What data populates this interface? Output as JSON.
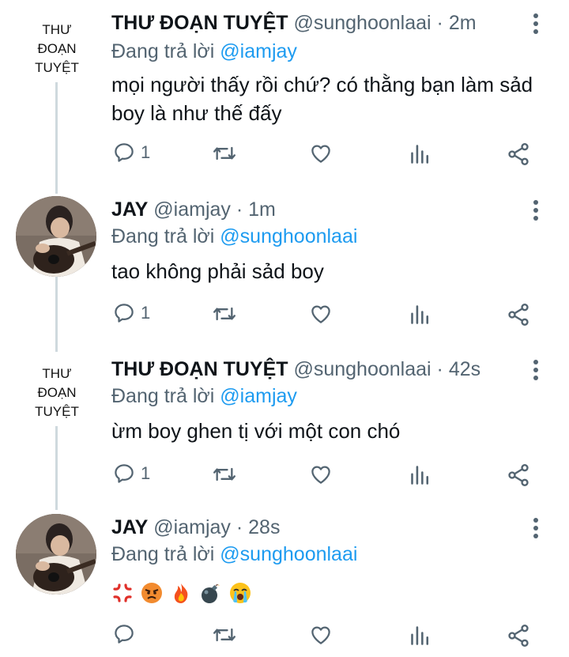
{
  "tweets": [
    {
      "avatar_text": [
        "THƯ",
        "ĐOẠN",
        "TUYỆT"
      ],
      "name": "THƯ ĐOẠN TUYỆT",
      "handle": "@sunghoonlaai",
      "time": "· 2m",
      "replying_prefix": "Đang trả lời",
      "replying_to": "@iamjay",
      "text": "mọi người thấy rồi chứ? có thằng bạn làm sảd boy là như thế đấy",
      "reply_count": "1"
    },
    {
      "name": "JAY",
      "handle": "@iamjay",
      "time": "· 1m",
      "replying_prefix": "Đang trả lời",
      "replying_to": "@sunghoonlaai",
      "text": "tao không phải sảd boy",
      "reply_count": "1"
    },
    {
      "avatar_text": [
        "THƯ",
        "ĐOẠN",
        "TUYỆT"
      ],
      "name": "THƯ ĐOẠN TUYỆT",
      "handle": "@sunghoonlaai",
      "time": "· 42s",
      "replying_prefix": "Đang trả lời",
      "replying_to": "@iamjay",
      "text": "ừm boy ghen tị với một con chó",
      "reply_count": "1"
    },
    {
      "name": "JAY",
      "handle": "@iamjay",
      "time": "· 28s",
      "replying_prefix": "Đang trả lời",
      "replying_to": "@sunghoonlaai",
      "emojis": [
        "anger-symbol",
        "angry-face",
        "fire",
        "bomb",
        "loudly-crying-face"
      ],
      "reply_count": ""
    }
  ],
  "icons": [
    "reply-icon",
    "retweet-icon",
    "like-icon",
    "views-icon",
    "share-icon",
    "more-icon"
  ],
  "colors": {
    "accent": "#1d9bf0",
    "secondary_text": "#536471",
    "thread_line": "#cfd9de"
  }
}
